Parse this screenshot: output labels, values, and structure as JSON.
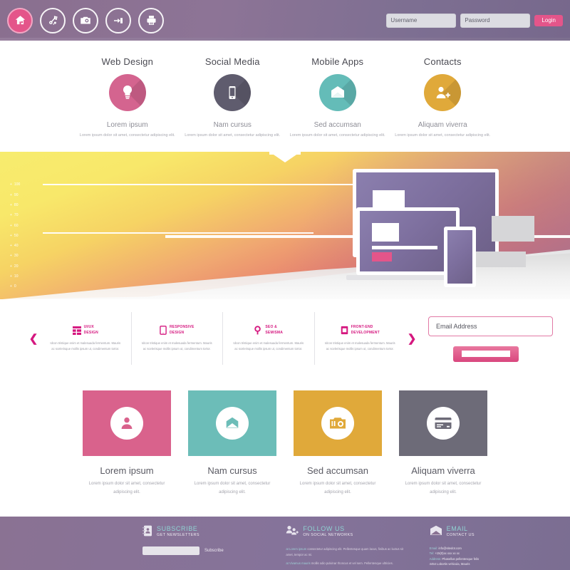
{
  "header": {
    "icons": [
      {
        "name": "home-icon",
        "label": "Home",
        "active": true
      },
      {
        "name": "settings-tools-icon",
        "label": "Settings",
        "active": false
      },
      {
        "name": "camera-icon",
        "label": "Gallery",
        "active": false
      },
      {
        "name": "key-login-icon",
        "label": "Login",
        "active": false
      },
      {
        "name": "printer-icon",
        "label": "Print",
        "active": false
      }
    ],
    "username_placeholder": "Username",
    "password_placeholder": "Password",
    "username_value": "",
    "password_value": "",
    "login_label": "Login"
  },
  "services": [
    {
      "title": "Web Design",
      "icon": "lightbulb-icon",
      "color": "#d4648f",
      "subtitle": "Lorem ipsum",
      "desc": "Lorem ipsum dolor sit amet, consectetur adipiscing elit."
    },
    {
      "title": "Social Media",
      "icon": "mobile-phone-icon",
      "color": "#5f5c6e",
      "subtitle": "Nam cursus",
      "desc": "Lorem ipsum dolor sit amet, consectetur adipiscing elit."
    },
    {
      "title": "Mobile Apps",
      "icon": "envelope-icon",
      "color": "#64bcb8",
      "subtitle": "Sed accumsan",
      "desc": "Lorem ipsum dolor sit amet, consectetur adipiscing elit."
    },
    {
      "title": "Contacts",
      "icon": "add-user-icon",
      "color": "#e0a93a",
      "subtitle": "Aliquam viverra",
      "desc": "Lorem ipsum dolor sit amet, consectetur adipiscing elit."
    }
  ],
  "hero": {
    "scale_ticks": [
      "100",
      "90",
      "80",
      "70",
      "60",
      "50",
      "40",
      "30",
      "20",
      "10",
      "0"
    ],
    "tick_marker": "+"
  },
  "features": {
    "prev_arrow": "❮",
    "next_arrow": "❯",
    "items": [
      {
        "icon": "layout-grid-icon",
        "line1": "UI/UX",
        "line2": "DESIGN",
        "text": "Idcon tristique enim et malesuada fermentum. Mauris ac scelerisque mollis ipsum ut, condimentum tortor."
      },
      {
        "icon": "tablet-icon",
        "line1": "RESPONSIVE",
        "line2": "DESIGN",
        "text": "Idcon tristique enim et malesuada fermentum. Mauris ac scelerisque mollis ipsum ut, condimentum tortor."
      },
      {
        "icon": "magnifier-icon",
        "line1": "SEO &",
        "line2": "SEM/SMA",
        "text": "Idcon tristique enim et malesuada fermentum. Mauris ac scelerisque mollis ipsum ut, condimentum tortor."
      },
      {
        "icon": "code-window-icon",
        "line1": "FRONT-END",
        "line2": "DEVELOPMENT",
        "text": "Idcon tristique enim et malesuada fermentum. Mauris ac scelerisque mollis ipsum ut, condimentum tortor."
      }
    ],
    "email_placeholder": "Email Address",
    "email_value": "",
    "submit_label": ""
  },
  "cards": [
    {
      "title": "Lorem ipsum",
      "icon": "user-icon",
      "color": "#d9628c",
      "desc": "Lorem ipsum dolor sit amet, consectetur adipiscing elit."
    },
    {
      "title": "Nam cursus",
      "icon": "envelope-icon",
      "color": "#6cbdb8",
      "desc": "Lorem ipsum dolor sit amet, consectetur adipiscing elit."
    },
    {
      "title": "Sed accumsan",
      "icon": "camera-icon",
      "color": "#e0a93a",
      "desc": "Lorem ipsum dolor sit amet, consectetur adipiscing elit."
    },
    {
      "title": "Aliquam viverra",
      "icon": "credit-card-icon",
      "color": "#6d6b78",
      "desc": "Lorem ipsum dolor sit amet, consectetur adipiscing elit."
    }
  ],
  "footer": {
    "subscribe": {
      "icon": "address-book-icon",
      "title": "SUBSCRIBE",
      "subtitle": "GET NEWSLETTERS",
      "input_value": "",
      "button_label": "Subscribe"
    },
    "follow": {
      "icon": "social-users-icon",
      "title": "FOLLOW US",
      "subtitle": "ON SOCIAL NETWORKS",
      "para1_lead": "at Lorem ipsum",
      "para1": "consectetur adipiscing elit. Pellentesque quam lacus, finibus ac luctus sit amet, tempor ac mi.",
      "para2_lead": "at Vivamus mauris",
      "para2": "mollis odio pulvinar rhoncus et vel sem. Pellentesque ultricies."
    },
    "email": {
      "icon": "envelope-icon",
      "title": "EMAIL",
      "subtitle": "CONTACT US",
      "lines": [
        {
          "label": "Email:",
          "value": "info@sitedot.com"
        },
        {
          "label": "Tel:",
          "value": "+15(0)xx xxx xx xx"
        },
        {
          "label": "Address:",
          "value": "Phasellus pellentesque felis"
        },
        {
          "label": "",
          "value": "4454 Lobortis vehicula, Mauris"
        }
      ]
    }
  },
  "colors": {
    "accent_pink": "#e4558a",
    "magenta": "#d5177f",
    "header_purple": "#8a7293",
    "teal": "#64bcb8",
    "gold": "#e0a93a",
    "gray": "#6d6b78"
  }
}
